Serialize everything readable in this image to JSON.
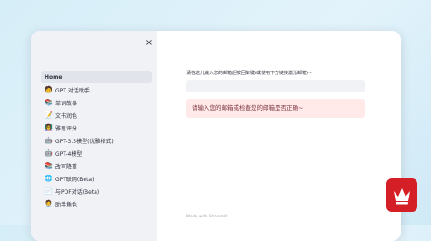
{
  "sidebar": {
    "close_icon": "×",
    "items": [
      {
        "icon": "",
        "label": "Home"
      },
      {
        "icon": "🧑",
        "label": "GPT 对话助手"
      },
      {
        "icon": "📚",
        "label": "单词故事"
      },
      {
        "icon": "📝",
        "label": "文书润色"
      },
      {
        "icon": "👩‍🏫",
        "label": "雅思评分"
      },
      {
        "icon": "🤖",
        "label": "GPT-3.5模型(优雅格式)"
      },
      {
        "icon": "🤖",
        "label": "GPT-4模型"
      },
      {
        "icon": "📚",
        "label": "改写降重"
      },
      {
        "icon": "🌐",
        "label": "GPT联网(Beta)"
      },
      {
        "icon": "📄",
        "label": "与PDF对话(Beta)"
      },
      {
        "icon": "🧑‍💼",
        "label": "助手角色"
      }
    ]
  },
  "main": {
    "prompt": "请在这儿输入您的邮箱后按回车键(或使用下方链接激活邮箱)~",
    "input_value": "",
    "error_message": "请输入您的邮箱或检查您的邮箱是否正确~",
    "footer_text": "Made with Streamlit"
  },
  "colors": {
    "accent": "#d31f25",
    "sidebar_bg": "#f0f2f6",
    "alert_bg": "#ffe9e9",
    "alert_text": "#7d353b",
    "page_bg": "#d6eef8"
  },
  "badge": {
    "icon": "crown-icon"
  }
}
